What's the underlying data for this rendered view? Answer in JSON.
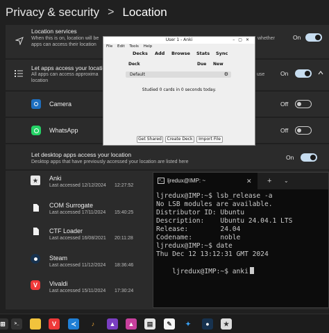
{
  "header": {
    "parent": "Privacy & security",
    "separator": ">",
    "current": "Location"
  },
  "location_services": {
    "title": "Location services",
    "sub1": "When this is on, location will be",
    "sub1_tail": "whether",
    "sub2": "apps can access their location",
    "state": "On"
  },
  "app_access": {
    "title": "Let apps access your locatio",
    "sub1": "All apps can access approxima",
    "sub1_tail": "use",
    "sub2": "location",
    "state": "On"
  },
  "apps": [
    {
      "name": "Camera",
      "state": "Off",
      "icon": "camera-icon",
      "color": "#1e6fc0"
    },
    {
      "name": "WhatsApp",
      "state": "Off",
      "icon": "whatsapp-icon",
      "color": "#25d366"
    }
  ],
  "desktop_apps": {
    "title": "Let desktop apps access your location",
    "sub": "Desktop apps that have previously accessed your location are listed here",
    "state": "On",
    "items": [
      {
        "name": "Anki",
        "date": "Last accessed 12/12/2024",
        "time": "12:27:52",
        "icon": "anki-icon"
      },
      {
        "name": "COM Surrogate",
        "date": "Last accessed 17/11/2024",
        "time": "15:40:25",
        "icon": "file-icon"
      },
      {
        "name": "CTF Loader",
        "date": "Last accessed 16/08/2021",
        "time": "20:11:28",
        "icon": "file-icon"
      },
      {
        "name": "Steam",
        "date": "Last accessed 11/12/2024",
        "time": "18:36:46",
        "icon": "steam-icon"
      },
      {
        "name": "Vivaldi",
        "date": "Last accessed 15/11/2024",
        "time": "17:30:24",
        "icon": "vivaldi-icon"
      }
    ]
  },
  "anki": {
    "title": "User 1 - Anki",
    "menu": [
      "File",
      "Edit",
      "Tools",
      "Help"
    ],
    "toolbar": [
      "Decks",
      "Add",
      "Browse",
      "Stats",
      "Sync"
    ],
    "columns": [
      "Deck",
      "Due",
      "New"
    ],
    "deck": "Default",
    "studied": "Studied 0 cards in 0 seconds today.",
    "buttons": [
      "Get Shared",
      "Create Deck",
      "Import File"
    ]
  },
  "terminal": {
    "tab_title": "ljredux@IMP: ~",
    "lines": [
      "ljredux@IMP:~$ lsb_release -a",
      "No LSB modules are available.",
      "Distributor ID: Ubuntu",
      "Description:    Ubuntu 24.04.1 LTS",
      "Release:        24.04",
      "Codename:       noble",
      "ljredux@IMP:~$ date",
      "Thu Dec 12 13:12:31 GMT 2024",
      "ljredux@IMP:~$ anki"
    ]
  },
  "taskbar": {
    "icons": [
      "start-icon",
      "terminal-icon",
      "file-explorer-icon",
      "vivaldi-icon",
      "vscode-icon",
      "music-icon",
      "affinity-icon",
      "notes-icon",
      "paint-icon",
      "sparkle-icon",
      "steam-icon",
      "settings-icon",
      "anki-icon"
    ]
  },
  "colors": {
    "background": "#202020",
    "card": "#2b2b2b",
    "toggle_on": "#c7ddf0",
    "terminal_bg": "#0c0c0c"
  }
}
